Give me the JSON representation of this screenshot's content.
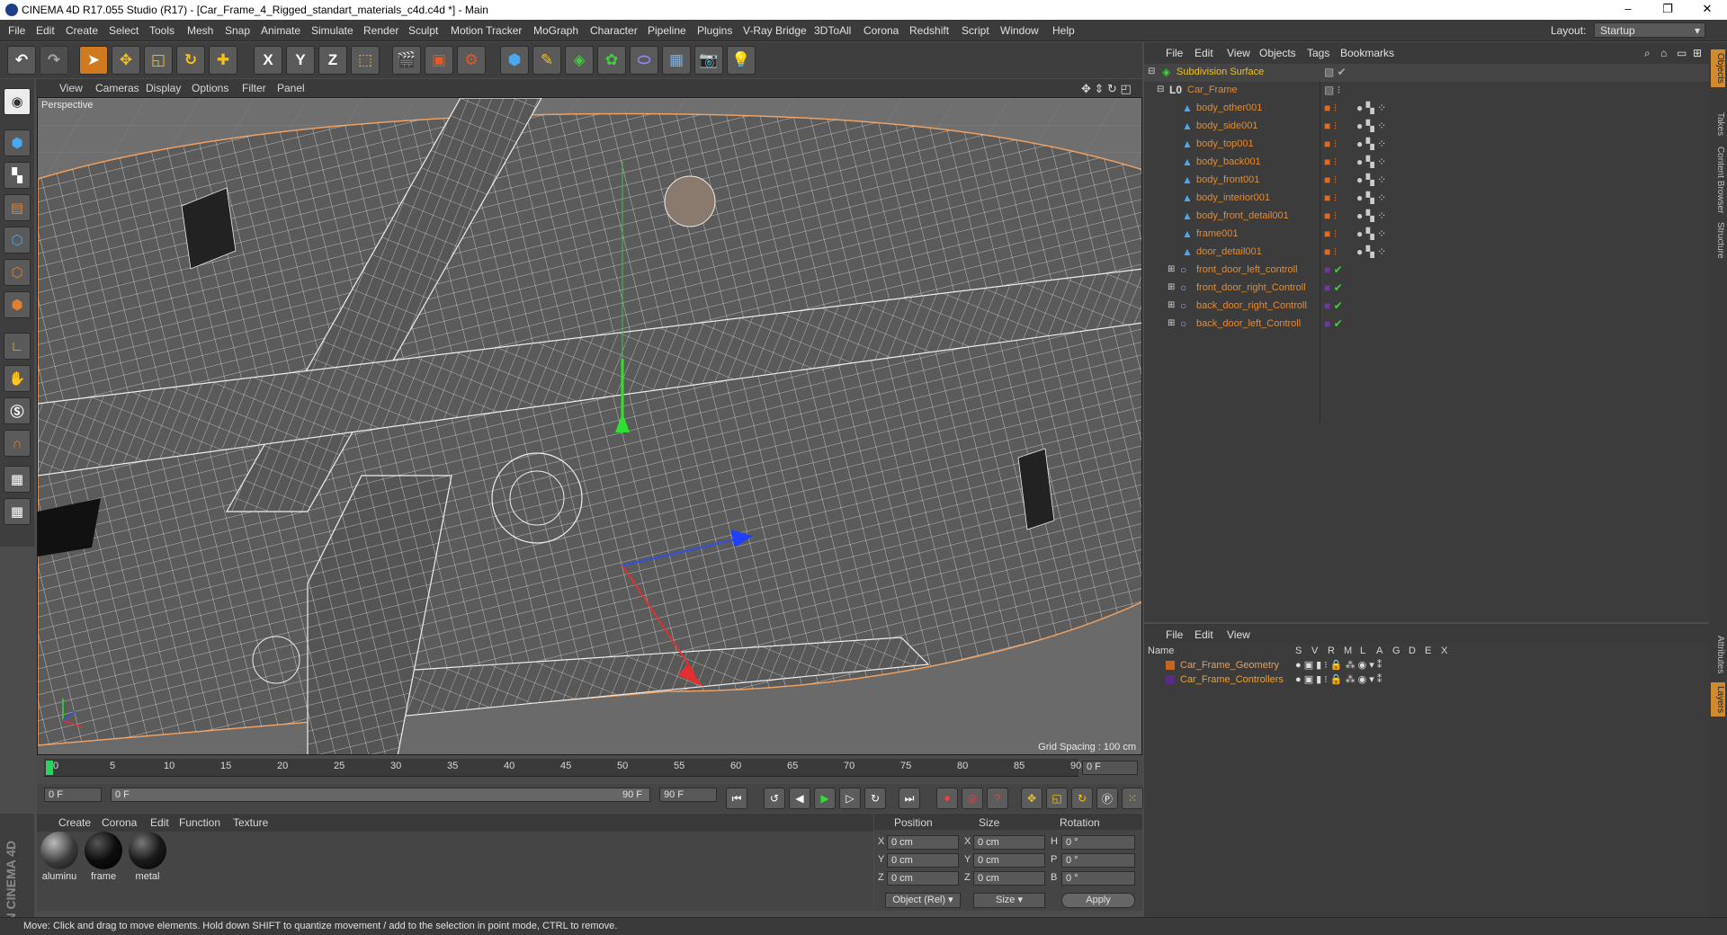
{
  "title": "CINEMA 4D R17.055 Studio (R17) - [Car_Frame_4_Rigged_standart_materials_c4d.c4d *] - Main",
  "window_controls": [
    "–",
    "❐",
    "✕"
  ],
  "menu": [
    "File",
    "Edit",
    "Create",
    "Select",
    "Tools",
    "Mesh",
    "Snap",
    "Animate",
    "Simulate",
    "Render",
    "Sculpt",
    "Motion Tracker",
    "MoGraph",
    "Character",
    "Pipeline",
    "Plugins",
    "V-Ray Bridge",
    "3DToAll",
    "Corona",
    "Redshift",
    "Script",
    "Window",
    "Help"
  ],
  "layout": {
    "label": "Layout:",
    "value": "Startup"
  },
  "toolbar_icons": [
    "undo-icon",
    "redo-icon",
    "select-arrow-icon",
    "move-icon",
    "scale-icon",
    "rotate-icon",
    "add-icon",
    "x-axis-icon",
    "y-axis-icon",
    "z-axis-icon",
    "world-coord-icon",
    "render-view-icon",
    "render-picture-viewer-icon",
    "render-settings-icon",
    "cube-icon",
    "pen-icon",
    "subdivision-icon",
    "array-icon",
    "deformer-icon",
    "floor-icon",
    "camera-icon",
    "light-icon"
  ],
  "toolbar_axes": [
    "X",
    "Y",
    "Z"
  ],
  "viewport": {
    "menu": [
      "View",
      "Cameras",
      "Display",
      "Options",
      "Filter",
      "Panel"
    ],
    "label": "Perspective",
    "grid_spacing": "Grid Spacing : 100 cm"
  },
  "timeline": {
    "ticks": [
      "0",
      "5",
      "10",
      "15",
      "20",
      "25",
      "30",
      "35",
      "40",
      "45",
      "50",
      "55",
      "60",
      "65",
      "70",
      "75",
      "80",
      "85",
      "90"
    ],
    "current_frame": "0 F",
    "start": "0 F",
    "range_start": "0 F",
    "range_end": "90 F",
    "end": "90 F"
  },
  "materials": {
    "menu": [
      "Create",
      "Corona",
      "Edit",
      "Function",
      "Texture"
    ],
    "items": [
      {
        "name": "aluminu",
        "color": "#3a3a3a"
      },
      {
        "name": "frame",
        "color": "#0d0d0d"
      },
      {
        "name": "metal",
        "color": "#1a1a1a"
      }
    ]
  },
  "coords": {
    "headers": [
      "Position",
      "Size",
      "Rotation"
    ],
    "rows": [
      {
        "axis": "X",
        "pos": "0 cm",
        "size_axis": "X",
        "size": "0 cm",
        "rot_axis": "H",
        "rot": "0 °"
      },
      {
        "axis": "Y",
        "pos": "0 cm",
        "size_axis": "Y",
        "size": "0 cm",
        "rot_axis": "P",
        "rot": "0 °"
      },
      {
        "axis": "Z",
        "pos": "0 cm",
        "size_axis": "Z",
        "size": "0 cm",
        "rot_axis": "B",
        "rot": "0 °"
      }
    ],
    "mode": "Object (Rel)",
    "size_mode": "Size",
    "apply": "Apply"
  },
  "objects": {
    "menu": [
      "File",
      "Edit",
      "View",
      "Objects",
      "Tags",
      "Bookmarks"
    ],
    "items": [
      {
        "name": "Subdivision Surface",
        "color": "#f0c020"
      },
      {
        "name": "Car_Frame",
        "color": "#e68a2e"
      },
      {
        "name": "body_other001",
        "color": "#e68a2e"
      },
      {
        "name": "body_side001",
        "color": "#e68a2e"
      },
      {
        "name": "body_top001",
        "color": "#e68a2e"
      },
      {
        "name": "body_back001",
        "color": "#e68a2e"
      },
      {
        "name": "body_front001",
        "color": "#e68a2e"
      },
      {
        "name": "body_interior001",
        "color": "#e68a2e"
      },
      {
        "name": "body_front_detail001",
        "color": "#e68a2e"
      },
      {
        "name": "frame001",
        "color": "#e68a2e"
      },
      {
        "name": "door_detail001",
        "color": "#e68a2e"
      },
      {
        "name": "front_door_left_controll",
        "color": "#e68a2e"
      },
      {
        "name": "front_door_right_Controll",
        "color": "#e68a2e"
      },
      {
        "name": "back_door_right_Controll",
        "color": "#e68a2e"
      },
      {
        "name": "back_door_left_Controll",
        "color": "#e68a2e"
      }
    ]
  },
  "layers": {
    "menu": [
      "File",
      "Edit",
      "View"
    ],
    "headers": [
      "Name",
      "S",
      "V",
      "R",
      "M",
      "L",
      "A",
      "G",
      "D",
      "E",
      "X"
    ],
    "items": [
      {
        "name": "Car_Frame_Geometry",
        "color": "#e0a060",
        "swatch": "#c8641e"
      },
      {
        "name": "Car_Frame_Controllers",
        "color": "#f0a030",
        "swatch": "#5a2a8a"
      }
    ]
  },
  "side_tabs": [
    "Objects",
    "Takes",
    "Content Browser",
    "Structure",
    "Attributes",
    "Layers"
  ],
  "maxon_logo": "MAXON CINEMA 4D",
  "status": "Move: Click and drag to move elements. Hold down SHIFT to quantize movement / add to the selection in point mode, CTRL to remove."
}
